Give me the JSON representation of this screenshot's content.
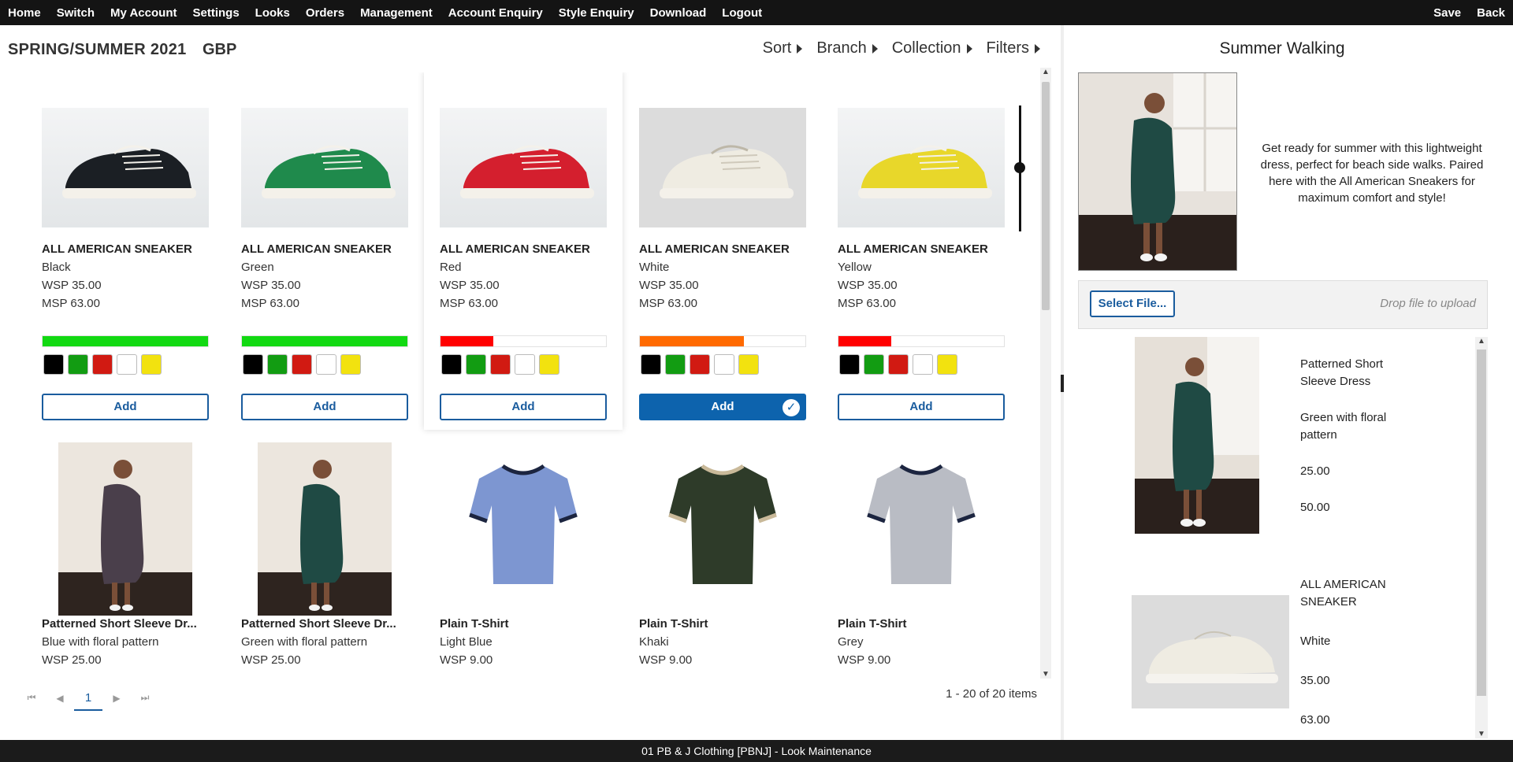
{
  "nav": {
    "left": [
      "Home",
      "Switch",
      "My Account",
      "Settings",
      "Looks",
      "Orders",
      "Management",
      "Account Enquiry",
      "Style Enquiry",
      "Download",
      "Logout"
    ],
    "right": [
      "Save",
      "Back"
    ]
  },
  "header": {
    "season": "SPRING/SUMMER 2021",
    "currency": "GBP",
    "menus": [
      "Sort",
      "Branch",
      "Collection",
      "Filters"
    ]
  },
  "products": [
    {
      "name": "ALL AMERICAN SNEAKER",
      "color": "Black",
      "wsp": "WSP 35.00",
      "msp": "MSP 63.00",
      "stock_fraction": 1.0,
      "stock_color": "#12d912",
      "add_label": "Add",
      "added": false,
      "shoe_color": "#1b1f24",
      "swatches": [
        "#000000",
        "#129c12",
        "#d11a12",
        "#ffffff",
        "#f2e20f"
      ]
    },
    {
      "name": "ALL AMERICAN SNEAKER",
      "color": "Green",
      "wsp": "WSP 35.00",
      "msp": "MSP 63.00",
      "stock_fraction": 1.0,
      "stock_color": "#12d912",
      "add_label": "Add",
      "added": false,
      "shoe_color": "#1f8a4c",
      "swatches": [
        "#000000",
        "#129c12",
        "#d11a12",
        "#ffffff",
        "#f2e20f"
      ]
    },
    {
      "name": "ALL AMERICAN SNEAKER",
      "color": "Red",
      "wsp": "WSP 35.00",
      "msp": "MSP 63.00",
      "stock_fraction": 0.32,
      "stock_color": "#ff0000",
      "add_label": "Add",
      "added": false,
      "shoe_color": "#d41f2e",
      "swatches": [
        "#000000",
        "#129c12",
        "#d11a12",
        "#ffffff",
        "#f2e20f"
      ]
    },
    {
      "name": "ALL AMERICAN SNEAKER",
      "color": "White",
      "wsp": "WSP 35.00",
      "msp": "MSP 63.00",
      "stock_fraction": 0.63,
      "stock_color": "#ff6a00",
      "add_label": "Add",
      "added": true,
      "shoe_color": "#efece2",
      "swatches": [
        "#000000",
        "#129c12",
        "#d11a12",
        "#ffffff",
        "#f2e20f"
      ]
    },
    {
      "name": "ALL AMERICAN SNEAKER",
      "color": "Yellow",
      "wsp": "WSP 35.00",
      "msp": "MSP 63.00",
      "stock_fraction": 0.32,
      "stock_color": "#ff0000",
      "add_label": "Add",
      "added": false,
      "shoe_color": "#e8d72a",
      "swatches": [
        "#000000",
        "#129c12",
        "#d11a12",
        "#ffffff",
        "#f2e20f"
      ]
    },
    {
      "name": "Patterned Short Sleeve Dr...",
      "color": "Blue with floral pattern",
      "wsp": "WSP 25.00",
      "kind": "dress",
      "dress_color": "#4a3f4b"
    },
    {
      "name": "Patterned Short Sleeve Dr...",
      "color": "Green with floral pattern",
      "wsp": "WSP 25.00",
      "kind": "dress",
      "dress_color": "#1f4a44"
    },
    {
      "name": "Plain T-Shirt",
      "color": "Light Blue",
      "wsp": "WSP 9.00",
      "kind": "tshirt",
      "shirt_color": "#7d96d1",
      "trim_color": "#1c2540"
    },
    {
      "name": "Plain T-Shirt",
      "color": "Khaki",
      "wsp": "WSP 9.00",
      "kind": "tshirt",
      "shirt_color": "#2e3b29",
      "trim_color": "#c9b999"
    },
    {
      "name": "Plain T-Shirt",
      "color": "Grey",
      "wsp": "WSP 9.00",
      "kind": "tshirt",
      "shirt_color": "#b9bcc4",
      "trim_color": "#1c2540"
    }
  ],
  "pager": {
    "current": "1",
    "summary": "1 - 20 of 20 items"
  },
  "look": {
    "title": "Summer Walking",
    "description": "Get ready for summer with this lightweight dress, perfect for beach side walks. Paired here with the All American Sneakers for maximum comfort and style!",
    "select_file_label": "Select File...",
    "drop_label": "Drop file to upload",
    "items": [
      {
        "name_line1": "Patterned Short",
        "name_line2": "Sleeve Dress",
        "color_line1": "Green with floral",
        "color_line2": "pattern",
        "price1": "25.00",
        "price2": "50.00"
      },
      {
        "name_line1": "ALL AMERICAN",
        "name_line2": "SNEAKER",
        "color_line1": "White",
        "color_line2": "",
        "price1": "35.00",
        "price2": "63.00"
      }
    ]
  },
  "footer": {
    "text": "01 PB & J Clothing [PBNJ] - Look Maintenance"
  }
}
